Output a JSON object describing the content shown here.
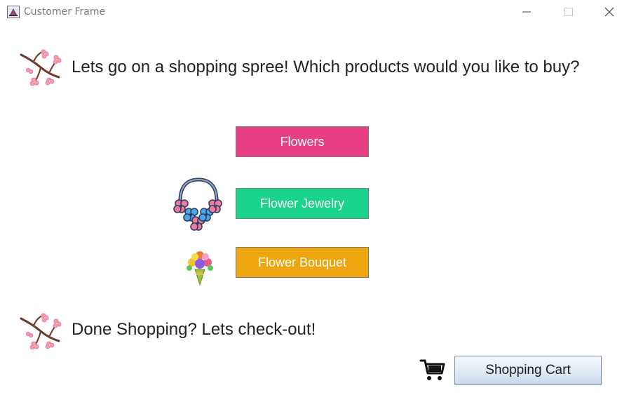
{
  "window": {
    "title": "Customer Frame"
  },
  "header": {
    "prompt": "Lets go on a shopping spree! Which products would you like to buy?"
  },
  "products": [
    {
      "label": "Flowers",
      "color": "#e83e84"
    },
    {
      "label": "Flower Jewelry",
      "color": "#19d48a"
    },
    {
      "label": "Flower Bouquet",
      "color": "#eda60d"
    }
  ],
  "checkout": {
    "prompt": "Done Shopping? Lets check-out!",
    "cart_button_label": "Shopping Cart"
  },
  "icons": {
    "app": "java-app-icon",
    "branch": "cherry-blossom-branch-icon",
    "jewelry": "flower-necklace-icon",
    "bouquet": "flower-bouquet-icon",
    "cart": "shopping-cart-icon"
  }
}
